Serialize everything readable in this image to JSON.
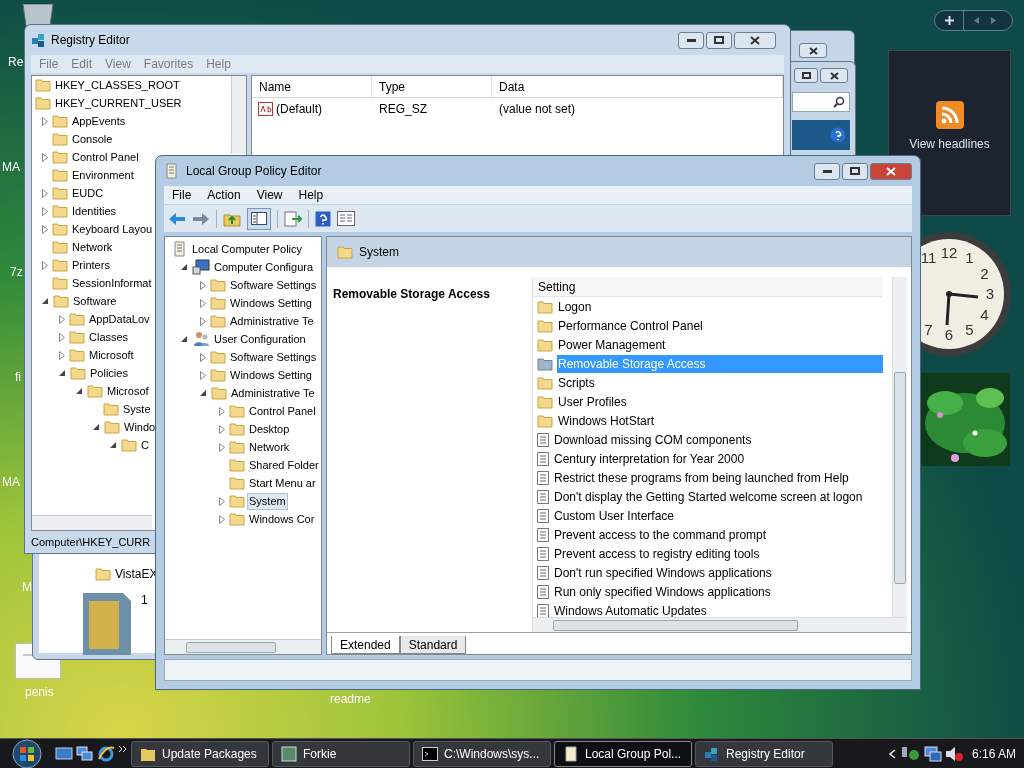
{
  "desktop": {
    "icon_labels": [
      {
        "label": "Re"
      },
      {
        "label": "MA"
      },
      {
        "label": "7z"
      },
      {
        "label": "fi"
      },
      {
        "label": "MA"
      },
      {
        "label": "M"
      },
      {
        "label": "penis"
      },
      {
        "label": "readme"
      }
    ]
  },
  "explorer_window": {
    "file_name": "VistaEX",
    "column_2": "1"
  },
  "registry_editor": {
    "title": "Registry Editor",
    "menu": [
      "File",
      "Edit",
      "View",
      "Favorites",
      "Help"
    ],
    "tree": [
      {
        "label": "HKEY_CLASSES_ROOT"
      },
      {
        "label": "HKEY_CURRENT_USER",
        "children": [
          {
            "label": "AppEvents",
            "expanded": false
          },
          {
            "label": "Console"
          },
          {
            "label": "Control Panel",
            "expanded": false
          },
          {
            "label": "Environment"
          },
          {
            "label": "EUDC",
            "expanded": false
          },
          {
            "label": "Identities",
            "expanded": false
          },
          {
            "label": "Keyboard Layou",
            "expanded": false
          },
          {
            "label": "Network"
          },
          {
            "label": "Printers",
            "expanded": false
          },
          {
            "label": "SessionInformat"
          },
          {
            "label": "Software",
            "expanded": true,
            "children": [
              {
                "label": "AppDataLov",
                "expanded": false
              },
              {
                "label": "Classes",
                "expanded": false
              },
              {
                "label": "Microsoft",
                "expanded": false
              },
              {
                "label": "Policies",
                "expanded": true,
                "children": [
                  {
                    "label": "Microsof",
                    "expanded": true,
                    "children": [
                      {
                        "label": "Syste"
                      },
                      {
                        "label": "Windo",
                        "expanded": true,
                        "children": [
                          {
                            "label": "C",
                            "expanded": true
                          }
                        ]
                      }
                    ]
                  }
                ]
              }
            ]
          }
        ]
      }
    ],
    "columns": [
      "Name",
      "Type",
      "Data"
    ],
    "rows": [
      {
        "name": "(Default)",
        "type": "REG_SZ",
        "data": "(value not set)"
      }
    ],
    "status_bar": "Computer\\HKEY_CURR"
  },
  "group_policy_editor": {
    "title": "Local Group Policy Editor",
    "menu": [
      "File",
      "Action",
      "View",
      "Help"
    ],
    "tree": [
      {
        "label": "Local Computer Policy",
        "kind": "policy",
        "selected": false,
        "children": [
          {
            "label": "Computer Configura",
            "kind": "computer",
            "expanded": true,
            "selected": false,
            "children": [
              {
                "label": "Software Settings",
                "kind": "folder",
                "expanded": false,
                "selected": false
              },
              {
                "label": "Windows Setting",
                "kind": "folder",
                "expanded": false,
                "selected": false
              },
              {
                "label": "Administrative Te",
                "kind": "folder",
                "expanded": false,
                "selected": false
              }
            ]
          },
          {
            "label": "User Configuration",
            "kind": "user",
            "expanded": true,
            "selected": false,
            "children": [
              {
                "label": "Software Settings",
                "kind": "folder",
                "expanded": false,
                "selected": false
              },
              {
                "label": "Windows Setting",
                "kind": "folder",
                "expanded": false,
                "selected": false
              },
              {
                "label": "Administrative Te",
                "kind": "folder",
                "expanded": true,
                "selected": false,
                "children": [
                  {
                    "label": "Control Panel",
                    "kind": "folder",
                    "expanded": false,
                    "selected": false
                  },
                  {
                    "label": "Desktop",
                    "kind": "folder",
                    "expanded": false,
                    "selected": false
                  },
                  {
                    "label": "Network",
                    "kind": "folder",
                    "expanded": false,
                    "selected": false
                  },
                  {
                    "label": "Shared Folder",
                    "kind": "folder",
                    "selected": false
                  },
                  {
                    "label": "Start Menu ar",
                    "kind": "folder",
                    "selected": false
                  },
                  {
                    "label": "System",
                    "kind": "folder",
                    "expanded": false,
                    "selected": true
                  },
                  {
                    "label": "Windows Cor",
                    "kind": "folder",
                    "expanded": false,
                    "selected": false
                  }
                ]
              }
            ]
          }
        ]
      }
    ],
    "header": "System",
    "description_title": "Removable Storage Access",
    "list_header": "Setting",
    "settings": [
      {
        "kind": "folder",
        "label": "Logon",
        "selected": false
      },
      {
        "kind": "folder",
        "label": "Performance Control Panel",
        "selected": false
      },
      {
        "kind": "folder",
        "label": "Power Management",
        "selected": false
      },
      {
        "kind": "folder",
        "label": "Removable Storage Access",
        "selected": true
      },
      {
        "kind": "folder",
        "label": "Scripts",
        "selected": false
      },
      {
        "kind": "folder",
        "label": "User Profiles",
        "selected": false
      },
      {
        "kind": "folder",
        "label": "Windows HotStart",
        "selected": false
      },
      {
        "kind": "setting",
        "label": "Download missing COM components",
        "selected": false
      },
      {
        "kind": "setting",
        "label": "Century interpretation for Year 2000",
        "selected": false
      },
      {
        "kind": "setting",
        "label": "Restrict these programs from being launched from Help",
        "selected": false
      },
      {
        "kind": "setting",
        "label": "Don't display the Getting Started welcome screen at logon",
        "selected": false
      },
      {
        "kind": "setting",
        "label": "Custom User Interface",
        "selected": false
      },
      {
        "kind": "setting",
        "label": "Prevent access to the command prompt",
        "selected": false
      },
      {
        "kind": "setting",
        "label": "Prevent access to registry editing tools",
        "selected": false
      },
      {
        "kind": "setting",
        "label": "Don't run specified Windows applications",
        "selected": false
      },
      {
        "kind": "setting",
        "label": "Run only specified Windows applications",
        "selected": false
      },
      {
        "kind": "setting",
        "label": "Windows Automatic Updates",
        "selected": false
      }
    ],
    "tabs": [
      {
        "label": "Extended",
        "selected": true
      },
      {
        "label": "Standard",
        "selected": false
      }
    ]
  },
  "sidebar": {
    "feed_label": "View headlines",
    "clock_numerals": [
      "11",
      "12",
      "1",
      "2",
      "3",
      "4",
      "5",
      "6",
      "7"
    ]
  },
  "taskbar": {
    "buttons": [
      {
        "kind": "folder",
        "label": "Update Packages",
        "selected": false
      },
      {
        "kind": "app",
        "label": "Forkie",
        "selected": false
      },
      {
        "kind": "console",
        "label": "C:\\Windows\\sys...",
        "selected": false
      },
      {
        "kind": "policy",
        "label": "Local Group Pol...",
        "selected": true
      },
      {
        "kind": "registry",
        "label": "Registry Editor",
        "selected": false
      }
    ],
    "time": "6:16 AM"
  }
}
